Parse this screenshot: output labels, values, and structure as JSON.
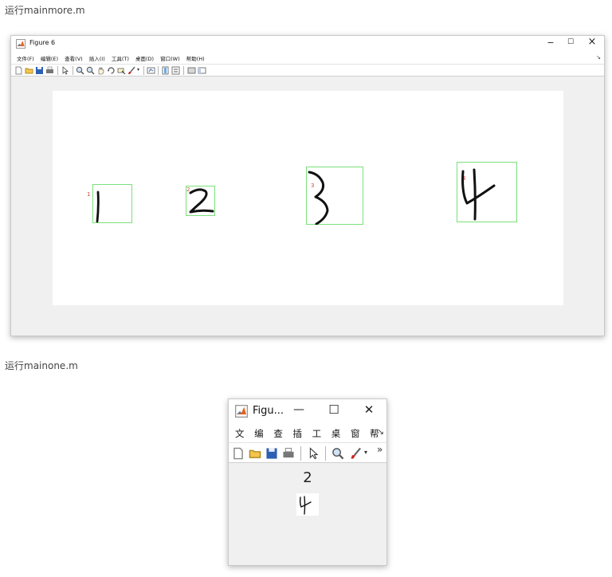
{
  "captions": {
    "first": "运行mainmore.m",
    "second": "运行mainone.m"
  },
  "figure_large": {
    "title": "Figure 6",
    "menu": [
      "文件(F)",
      "编辑(E)",
      "查看(V)",
      "插入(I)",
      "工具(T)",
      "桌面(D)",
      "窗口(W)",
      "帮助(H)"
    ],
    "overflow_arrow": "↘",
    "window_buttons": {
      "minimize": "−",
      "maximize": "☐",
      "close": "×"
    },
    "detections": [
      {
        "label": "1",
        "digit": "1"
      },
      {
        "label": "2",
        "digit": "2"
      },
      {
        "label": "3",
        "digit": "3"
      },
      {
        "label": "4",
        "digit": "4"
      }
    ]
  },
  "figure_small": {
    "title": "Figu...",
    "menu": [
      "文",
      "编",
      "查",
      "插",
      "工",
      "桌",
      "窗",
      "帮"
    ],
    "overflow_arrow": "↘",
    "toolbar_more": "»",
    "window_buttons": {
      "minimize": "—",
      "maximize": "☐",
      "close": "✕"
    },
    "result": "2"
  },
  "colors": {
    "box": "#7be07b",
    "label": "#e04444",
    "window_bg": "#f0f0f0"
  }
}
